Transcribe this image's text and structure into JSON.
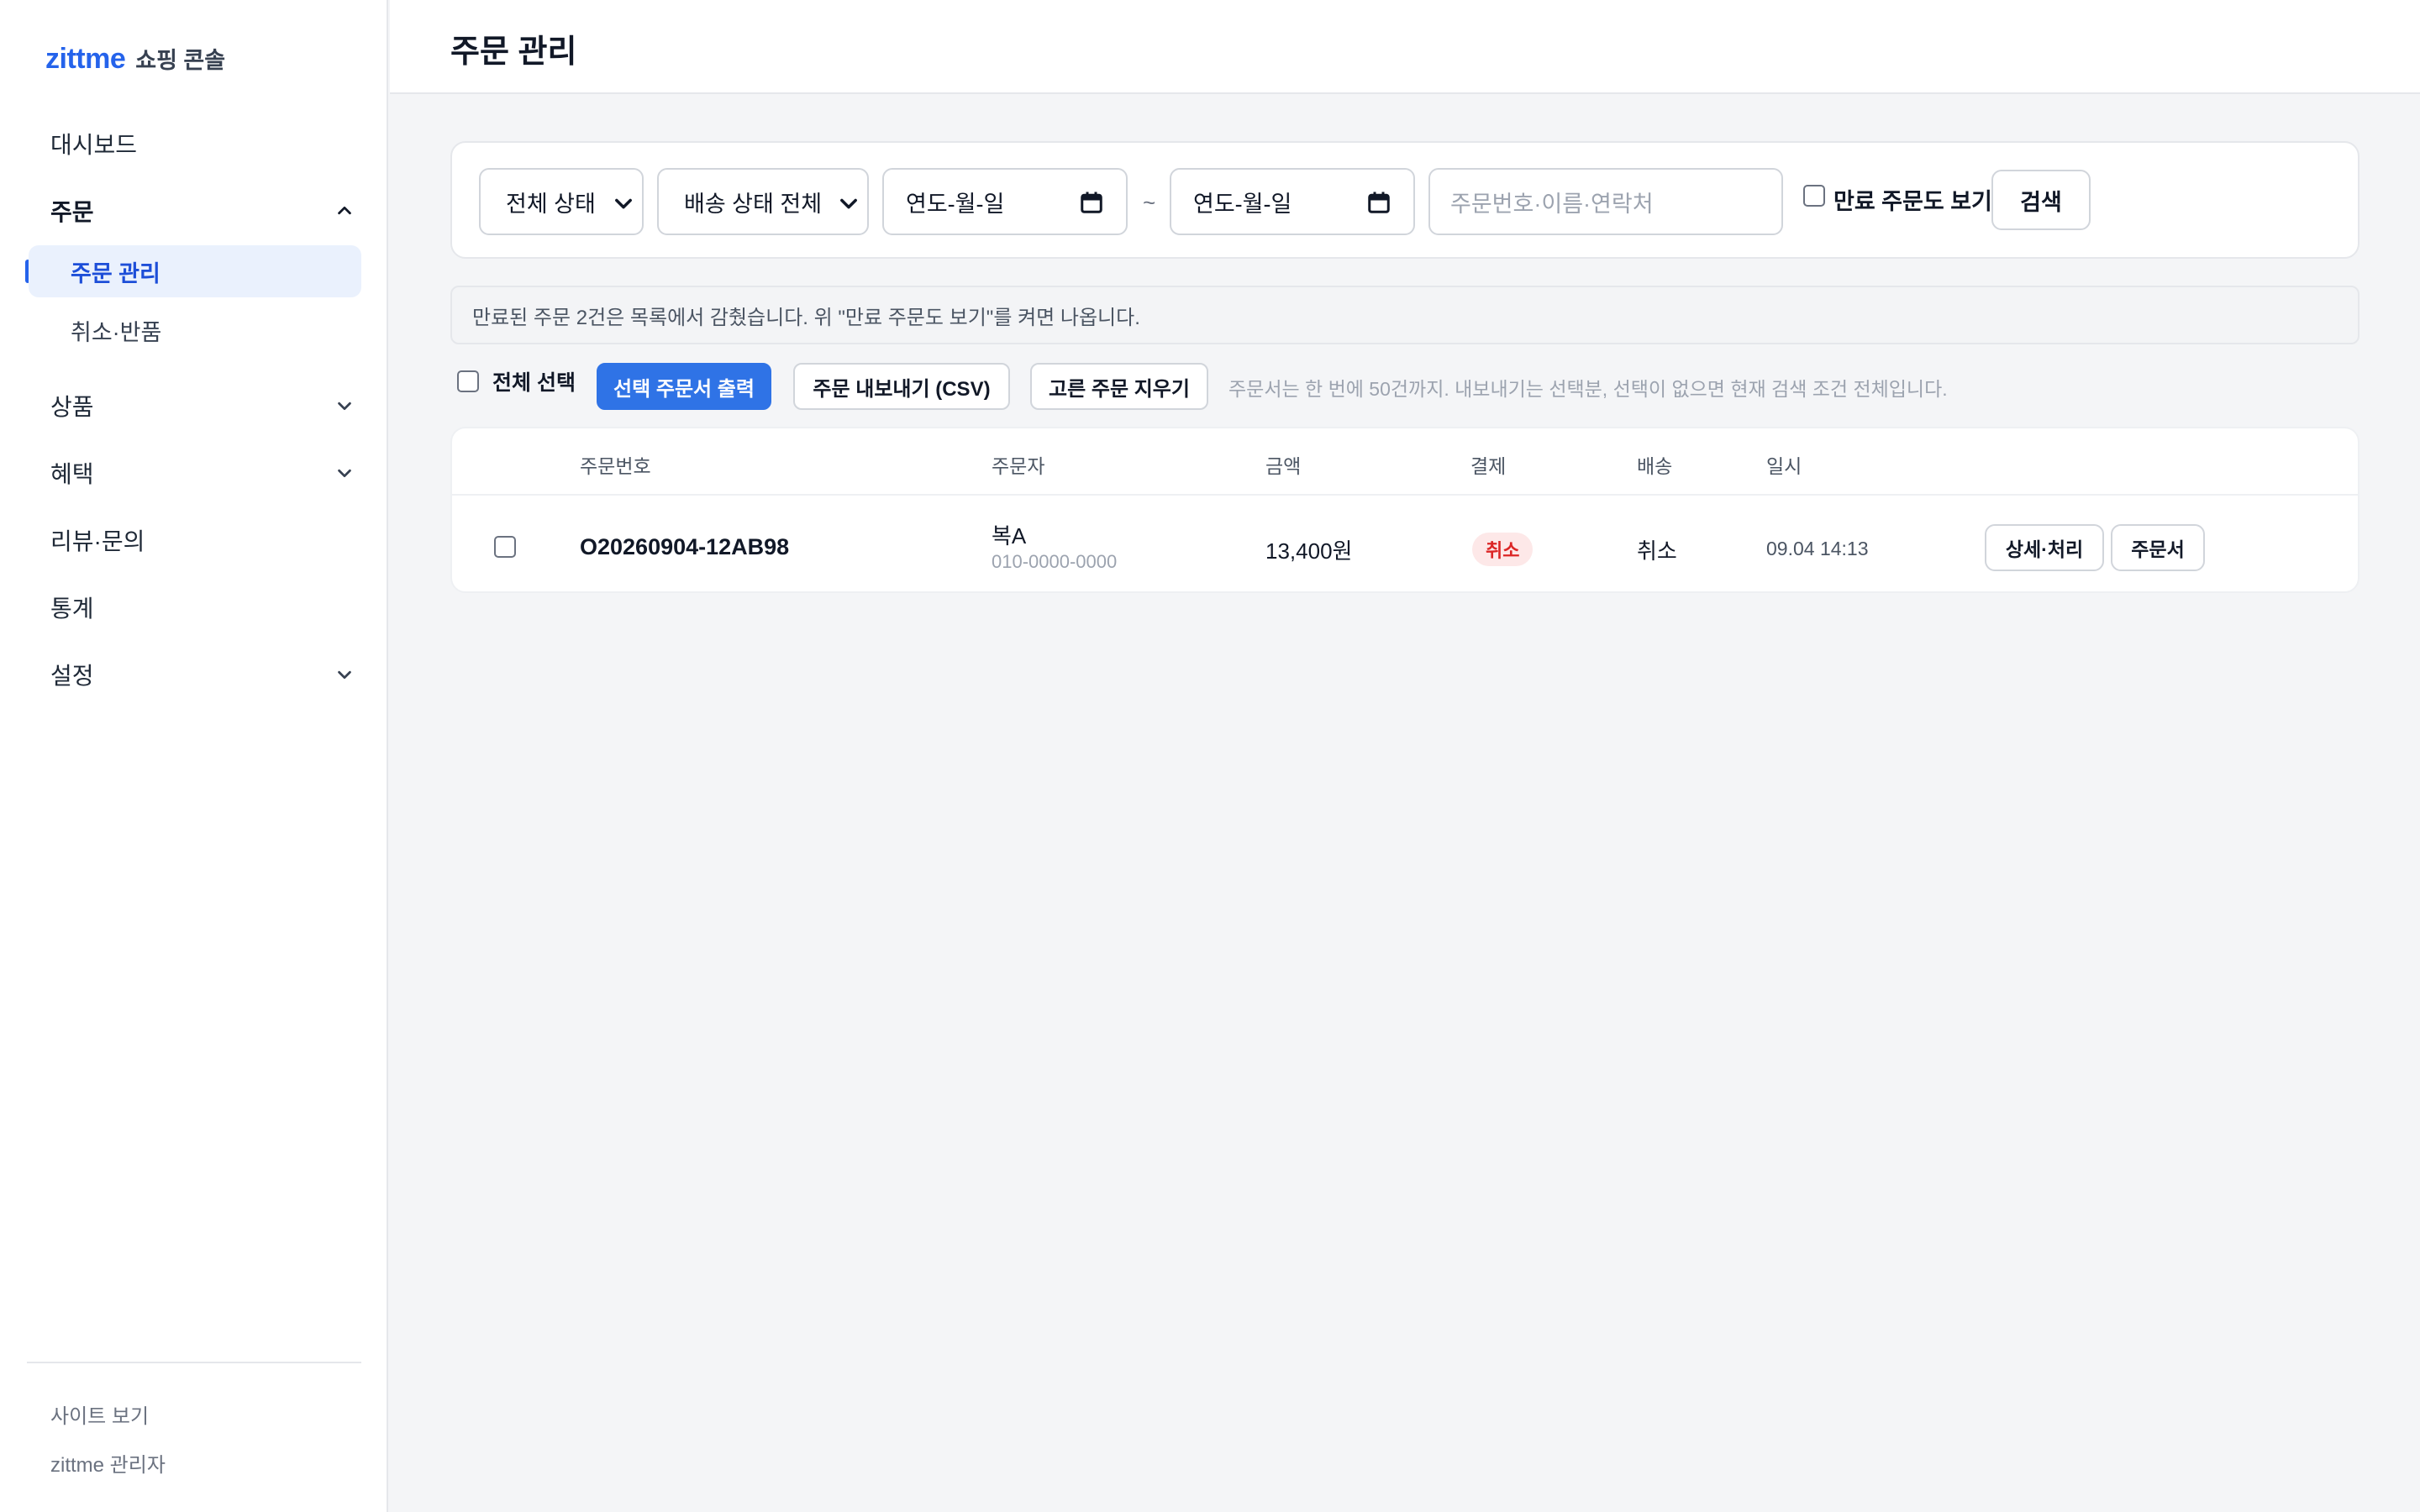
{
  "brand": {
    "logo": "zittme",
    "subtitle": "쇼핑 콘솔"
  },
  "sidebar": {
    "items": [
      {
        "label": "대시보드"
      },
      {
        "label": "주문"
      },
      {
        "label": "주문 관리"
      },
      {
        "label": "취소·반품"
      },
      {
        "label": "상품"
      },
      {
        "label": "혜택"
      },
      {
        "label": "리뷰·문의"
      },
      {
        "label": "통계"
      },
      {
        "label": "설정"
      }
    ],
    "footer": {
      "site_link": "사이트 보기",
      "admin_label": "zittme 관리자"
    }
  },
  "header": {
    "title": "주문 관리"
  },
  "filters": {
    "status_select": "전체 상태",
    "shipping_select": "배송 상태 전체",
    "date_from_placeholder": "연도-월-일",
    "date_separator": "~",
    "date_to_placeholder": "연도-월-일",
    "search_placeholder": "주문번호·이름·연락처",
    "show_expired_label": "만료 주문도 보기",
    "search_button": "검색"
  },
  "notice": {
    "text": "만료된 주문 2건은 목록에서 감췄습니다. 위 \"만료 주문도 보기\"를 켜면 나옵니다."
  },
  "toolbar": {
    "select_all_label": "전체 선택",
    "print_button": "선택 주문서 출력",
    "export_button": "주문 내보내기 (CSV)",
    "clear_button": "고른 주문 지우기",
    "hint": "주문서는 한 번에 50건까지. 내보내기는 선택분, 선택이 없으면 현재 검색 조건 전체입니다."
  },
  "table": {
    "headers": {
      "order_no": "주문번호",
      "buyer": "주문자",
      "amount": "금액",
      "payment": "결제",
      "shipping": "배송",
      "date": "일시"
    },
    "rows": [
      {
        "order_no": "O20260904-12AB98",
        "buyer_name": "복A",
        "buyer_phone": "010-0000-0000",
        "amount": "13,400원",
        "payment_status": "취소",
        "shipping_status": "취소",
        "date": "09.04 14:13",
        "detail_button": "상세·처리",
        "invoice_button": "주문서"
      }
    ]
  },
  "colors": {
    "accent": "#2563eb",
    "primary_button": "#2f73e6",
    "cancel_badge_bg": "#fde8e8",
    "cancel_badge_text": "#dc2626"
  }
}
